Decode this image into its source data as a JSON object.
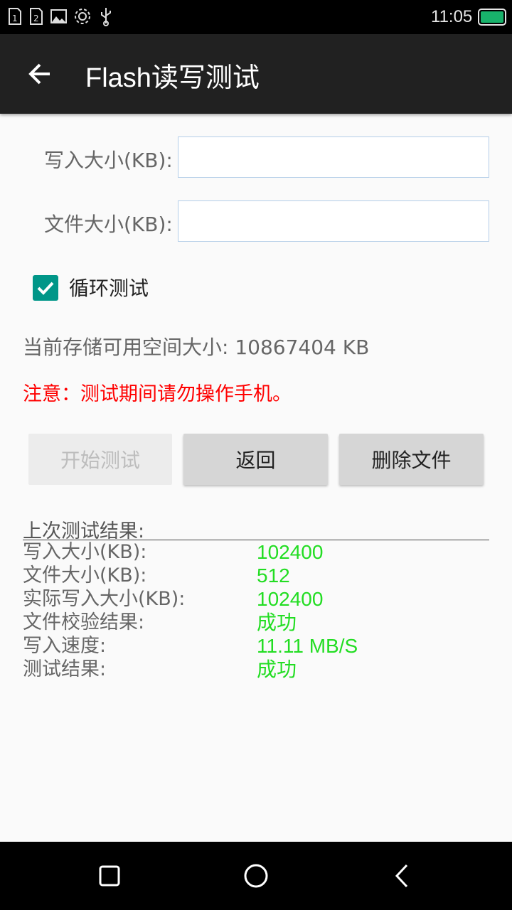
{
  "status_bar": {
    "time": "11:05",
    "icons": [
      "sim1-icon",
      "sim2-icon",
      "image-icon",
      "gear-icon",
      "usb-icon"
    ],
    "battery_color": "#18b26b"
  },
  "toolbar": {
    "title": "Flash读写测试",
    "back_icon": "arrow-back-icon"
  },
  "form": {
    "write_size_label": "写入大小(KB):",
    "write_size_value": "",
    "file_size_label": "文件大小(KB):",
    "file_size_value": "",
    "loop_test_label": "循环测试",
    "loop_test_checked": true
  },
  "storage_info": "当前存储可用空间大小: 10867404 KB",
  "warning": "注意：测试期间请勿操作手机。",
  "buttons": {
    "start": "开始测试",
    "back": "返回",
    "delete": "删除文件"
  },
  "results": {
    "heading": "上次测试结果:",
    "rows": [
      {
        "label": "写入大小(KB):",
        "value": "102400"
      },
      {
        "label": "文件大小(KB):",
        "value": "512"
      },
      {
        "label": "实际写入大小(KB):",
        "value": "102400"
      },
      {
        "label": "文件校验结果:",
        "value": "成功"
      },
      {
        "label": "写入速度:",
        "value": "11.11 MB/S"
      },
      {
        "label": "测试结果:",
        "value": "成功"
      }
    ]
  },
  "colors": {
    "accent": "#009688",
    "warning": "#ff0000",
    "success": "#22dd22"
  },
  "nav_bar": {
    "icons": [
      "recents-square-icon",
      "home-circle-icon",
      "back-triangle-icon"
    ]
  }
}
